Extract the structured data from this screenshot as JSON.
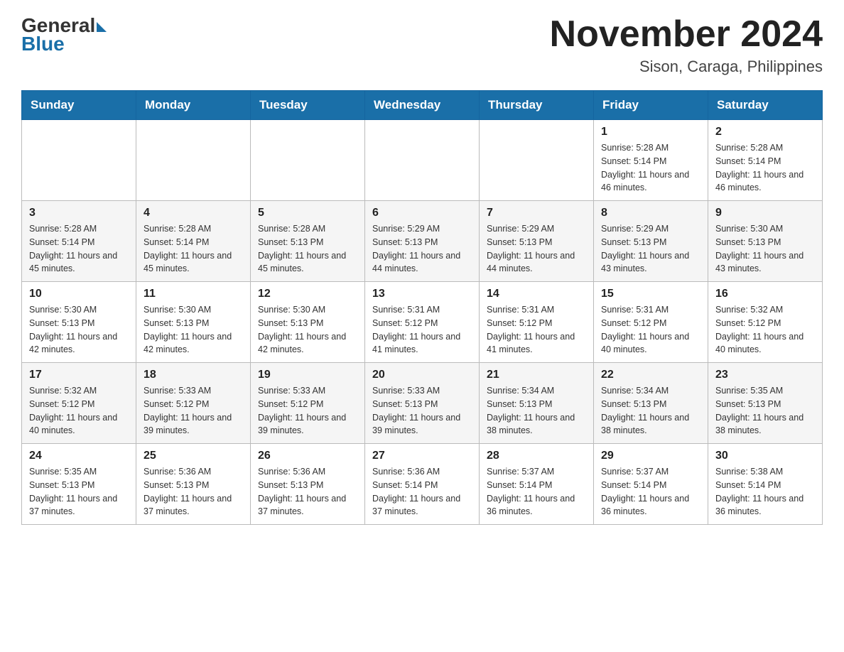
{
  "header": {
    "logo_general": "General",
    "logo_blue": "Blue",
    "month_title": "November 2024",
    "location": "Sison, Caraga, Philippines"
  },
  "days_of_week": [
    "Sunday",
    "Monday",
    "Tuesday",
    "Wednesday",
    "Thursday",
    "Friday",
    "Saturday"
  ],
  "weeks": [
    [
      {
        "day": "",
        "info": ""
      },
      {
        "day": "",
        "info": ""
      },
      {
        "day": "",
        "info": ""
      },
      {
        "day": "",
        "info": ""
      },
      {
        "day": "",
        "info": ""
      },
      {
        "day": "1",
        "info": "Sunrise: 5:28 AM\nSunset: 5:14 PM\nDaylight: 11 hours and 46 minutes."
      },
      {
        "day": "2",
        "info": "Sunrise: 5:28 AM\nSunset: 5:14 PM\nDaylight: 11 hours and 46 minutes."
      }
    ],
    [
      {
        "day": "3",
        "info": "Sunrise: 5:28 AM\nSunset: 5:14 PM\nDaylight: 11 hours and 45 minutes."
      },
      {
        "day": "4",
        "info": "Sunrise: 5:28 AM\nSunset: 5:14 PM\nDaylight: 11 hours and 45 minutes."
      },
      {
        "day": "5",
        "info": "Sunrise: 5:28 AM\nSunset: 5:13 PM\nDaylight: 11 hours and 45 minutes."
      },
      {
        "day": "6",
        "info": "Sunrise: 5:29 AM\nSunset: 5:13 PM\nDaylight: 11 hours and 44 minutes."
      },
      {
        "day": "7",
        "info": "Sunrise: 5:29 AM\nSunset: 5:13 PM\nDaylight: 11 hours and 44 minutes."
      },
      {
        "day": "8",
        "info": "Sunrise: 5:29 AM\nSunset: 5:13 PM\nDaylight: 11 hours and 43 minutes."
      },
      {
        "day": "9",
        "info": "Sunrise: 5:30 AM\nSunset: 5:13 PM\nDaylight: 11 hours and 43 minutes."
      }
    ],
    [
      {
        "day": "10",
        "info": "Sunrise: 5:30 AM\nSunset: 5:13 PM\nDaylight: 11 hours and 42 minutes."
      },
      {
        "day": "11",
        "info": "Sunrise: 5:30 AM\nSunset: 5:13 PM\nDaylight: 11 hours and 42 minutes."
      },
      {
        "day": "12",
        "info": "Sunrise: 5:30 AM\nSunset: 5:13 PM\nDaylight: 11 hours and 42 minutes."
      },
      {
        "day": "13",
        "info": "Sunrise: 5:31 AM\nSunset: 5:12 PM\nDaylight: 11 hours and 41 minutes."
      },
      {
        "day": "14",
        "info": "Sunrise: 5:31 AM\nSunset: 5:12 PM\nDaylight: 11 hours and 41 minutes."
      },
      {
        "day": "15",
        "info": "Sunrise: 5:31 AM\nSunset: 5:12 PM\nDaylight: 11 hours and 40 minutes."
      },
      {
        "day": "16",
        "info": "Sunrise: 5:32 AM\nSunset: 5:12 PM\nDaylight: 11 hours and 40 minutes."
      }
    ],
    [
      {
        "day": "17",
        "info": "Sunrise: 5:32 AM\nSunset: 5:12 PM\nDaylight: 11 hours and 40 minutes."
      },
      {
        "day": "18",
        "info": "Sunrise: 5:33 AM\nSunset: 5:12 PM\nDaylight: 11 hours and 39 minutes."
      },
      {
        "day": "19",
        "info": "Sunrise: 5:33 AM\nSunset: 5:12 PM\nDaylight: 11 hours and 39 minutes."
      },
      {
        "day": "20",
        "info": "Sunrise: 5:33 AM\nSunset: 5:13 PM\nDaylight: 11 hours and 39 minutes."
      },
      {
        "day": "21",
        "info": "Sunrise: 5:34 AM\nSunset: 5:13 PM\nDaylight: 11 hours and 38 minutes."
      },
      {
        "day": "22",
        "info": "Sunrise: 5:34 AM\nSunset: 5:13 PM\nDaylight: 11 hours and 38 minutes."
      },
      {
        "day": "23",
        "info": "Sunrise: 5:35 AM\nSunset: 5:13 PM\nDaylight: 11 hours and 38 minutes."
      }
    ],
    [
      {
        "day": "24",
        "info": "Sunrise: 5:35 AM\nSunset: 5:13 PM\nDaylight: 11 hours and 37 minutes."
      },
      {
        "day": "25",
        "info": "Sunrise: 5:36 AM\nSunset: 5:13 PM\nDaylight: 11 hours and 37 minutes."
      },
      {
        "day": "26",
        "info": "Sunrise: 5:36 AM\nSunset: 5:13 PM\nDaylight: 11 hours and 37 minutes."
      },
      {
        "day": "27",
        "info": "Sunrise: 5:36 AM\nSunset: 5:14 PM\nDaylight: 11 hours and 37 minutes."
      },
      {
        "day": "28",
        "info": "Sunrise: 5:37 AM\nSunset: 5:14 PM\nDaylight: 11 hours and 36 minutes."
      },
      {
        "day": "29",
        "info": "Sunrise: 5:37 AM\nSunset: 5:14 PM\nDaylight: 11 hours and 36 minutes."
      },
      {
        "day": "30",
        "info": "Sunrise: 5:38 AM\nSunset: 5:14 PM\nDaylight: 11 hours and 36 minutes."
      }
    ]
  ]
}
